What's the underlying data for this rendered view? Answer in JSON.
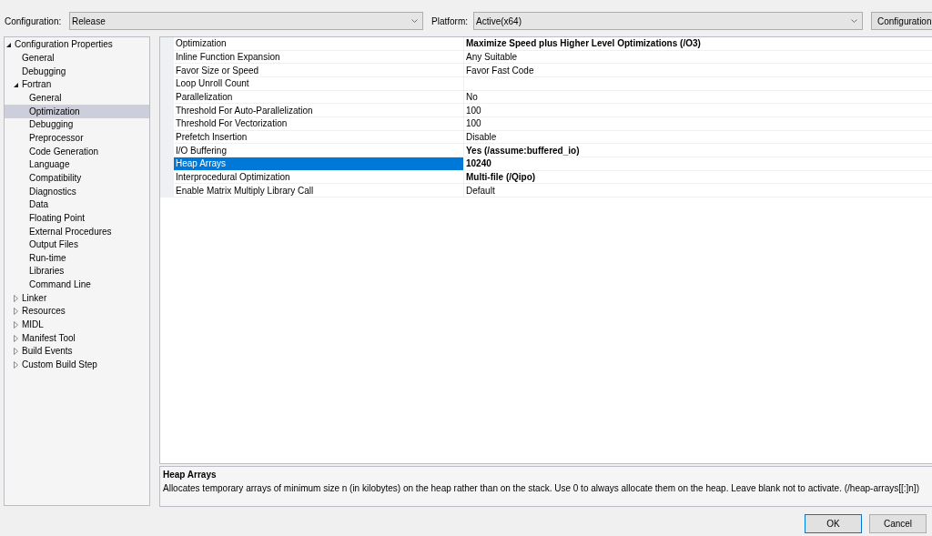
{
  "toolbar": {
    "configuration_label": "Configuration:",
    "configuration_value": "Release",
    "platform_label": "Platform:",
    "platform_value": "Active(x64)",
    "manager_button": "Configuration"
  },
  "tree": [
    {
      "label": "Configuration Properties",
      "expanded": true,
      "selected": false,
      "children": [
        {
          "label": "General",
          "selected": false
        },
        {
          "label": "Debugging",
          "selected": false
        },
        {
          "label": "Fortran",
          "expanded": true,
          "selected": false,
          "children": [
            {
              "label": "General",
              "selected": false
            },
            {
              "label": "Optimization",
              "selected": true
            },
            {
              "label": "Debugging",
              "selected": false
            },
            {
              "label": "Preprocessor",
              "selected": false
            },
            {
              "label": "Code Generation",
              "selected": false
            },
            {
              "label": "Language",
              "selected": false
            },
            {
              "label": "Compatibility",
              "selected": false
            },
            {
              "label": "Diagnostics",
              "selected": false
            },
            {
              "label": "Data",
              "selected": false
            },
            {
              "label": "Floating Point",
              "selected": false
            },
            {
              "label": "External Procedures",
              "selected": false
            },
            {
              "label": "Output Files",
              "selected": false
            },
            {
              "label": "Run-time",
              "selected": false
            },
            {
              "label": "Libraries",
              "selected": false
            },
            {
              "label": "Command Line",
              "selected": false
            }
          ]
        },
        {
          "label": "Linker",
          "expanded": false,
          "selected": false
        },
        {
          "label": "Resources",
          "expanded": false,
          "selected": false
        },
        {
          "label": "MIDL",
          "expanded": false,
          "selected": false
        },
        {
          "label": "Manifest Tool",
          "expanded": false,
          "selected": false
        },
        {
          "label": "Build Events",
          "expanded": false,
          "selected": false
        },
        {
          "label": "Custom Build Step",
          "expanded": false,
          "selected": false
        }
      ]
    }
  ],
  "properties": [
    {
      "name": "Optimization",
      "value": "Maximize Speed plus Higher Level Optimizations (/O3)",
      "bold": true,
      "selected": false
    },
    {
      "name": "Inline Function Expansion",
      "value": "Any Suitable",
      "bold": false,
      "selected": false
    },
    {
      "name": "Favor Size or Speed",
      "value": "Favor Fast Code",
      "bold": false,
      "selected": false
    },
    {
      "name": "Loop Unroll Count",
      "selected": false
    },
    {
      "name": "Parallelization",
      "value": "No",
      "bold": false,
      "selected": false
    },
    {
      "name": "Threshold For Auto-Parallelization",
      "value": "100",
      "bold": false,
      "selected": false
    },
    {
      "name": "Threshold For Vectorization",
      "value": "100",
      "bold": false,
      "selected": false
    },
    {
      "name": "Prefetch Insertion",
      "value": "Disable",
      "bold": false,
      "selected": false
    },
    {
      "name": "I/O Buffering",
      "value": "Yes (/assume:buffered_io)",
      "bold": true,
      "selected": false
    },
    {
      "name": "Heap Arrays",
      "value": "10240",
      "bold": true,
      "selected": true
    },
    {
      "name": "Interprocedural Optimization",
      "value": "Multi-file (/Qipo)",
      "bold": true,
      "selected": false
    },
    {
      "name": "Enable Matrix Multiply Library Call",
      "value": "Default",
      "bold": false,
      "selected": false
    }
  ],
  "description": {
    "title": "Heap Arrays",
    "text": "Allocates temporary arrays of minimum size n (in kilobytes) on the heap rather than on the stack. Use 0 to always allocate them on the heap. Leave blank not to activate. (/heap-arrays[[:]n])"
  },
  "buttons": [
    {
      "label": "OK",
      "default": true
    },
    {
      "label": "Cancel",
      "default": false
    }
  ]
}
